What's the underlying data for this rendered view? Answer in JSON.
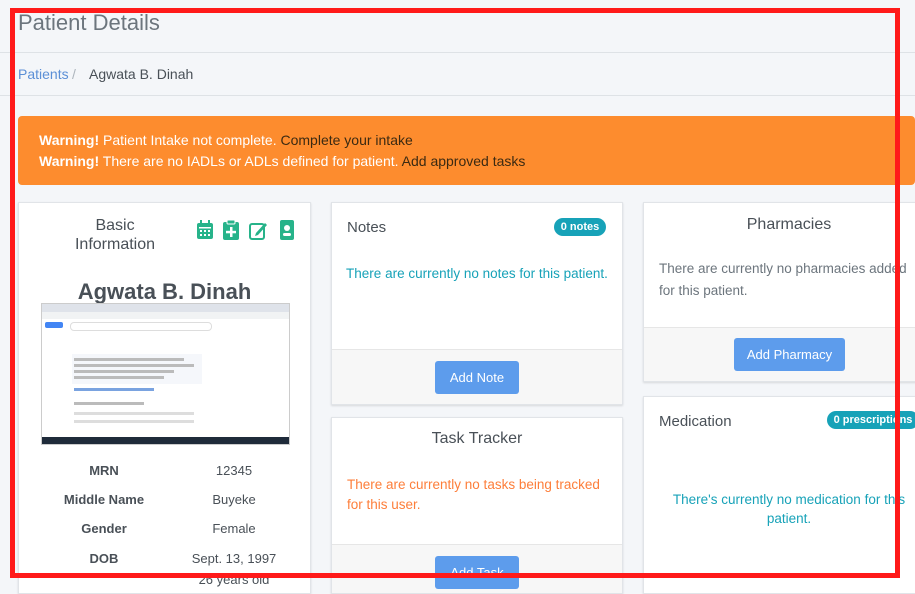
{
  "header": {
    "title": "Patient Details"
  },
  "breadcrumb": {
    "parent": "Patients",
    "separator": "/",
    "current": "Agwata B. Dinah"
  },
  "alerts": [
    {
      "label": "Warning!",
      "text": "Patient Intake not complete.",
      "action": "Complete your intake"
    },
    {
      "label": "Warning!",
      "text": "There are no IADLs or ADLs defined for patient.",
      "action": "Add approved tasks"
    }
  ],
  "basic_info": {
    "title_line1": "Basic",
    "title_line2": "Information",
    "patient_name": "Agwata B. Dinah",
    "fields": [
      {
        "label": "MRN",
        "value": "12345"
      },
      {
        "label": "Middle Name",
        "value": "Buyeke"
      },
      {
        "label": "Gender",
        "value": "Female"
      },
      {
        "label": "DOB",
        "value": "Sept. 13, 1997"
      }
    ],
    "age": "26 years old"
  },
  "notes": {
    "title": "Notes",
    "badge": "0 notes",
    "empty": "There are currently no notes for this patient.",
    "button": "Add Note"
  },
  "task_tracker": {
    "title": "Task Tracker",
    "empty": "There are currently no tasks being tracked for this user.",
    "button": "Add Task"
  },
  "pharmacies": {
    "title": "Pharmacies",
    "empty": "There are currently no pharmacies added for this patient.",
    "button": "Add Pharmacy"
  },
  "medication": {
    "title": "Medication",
    "badge": "0 prescriptions",
    "empty": "There's currently no medication for this patient."
  },
  "colors": {
    "accent": "#5d9cec",
    "warning": "#fd8c2e",
    "info": "#17a2b8",
    "icon_green": "#27b38a",
    "frame": "#ff1a1a"
  }
}
